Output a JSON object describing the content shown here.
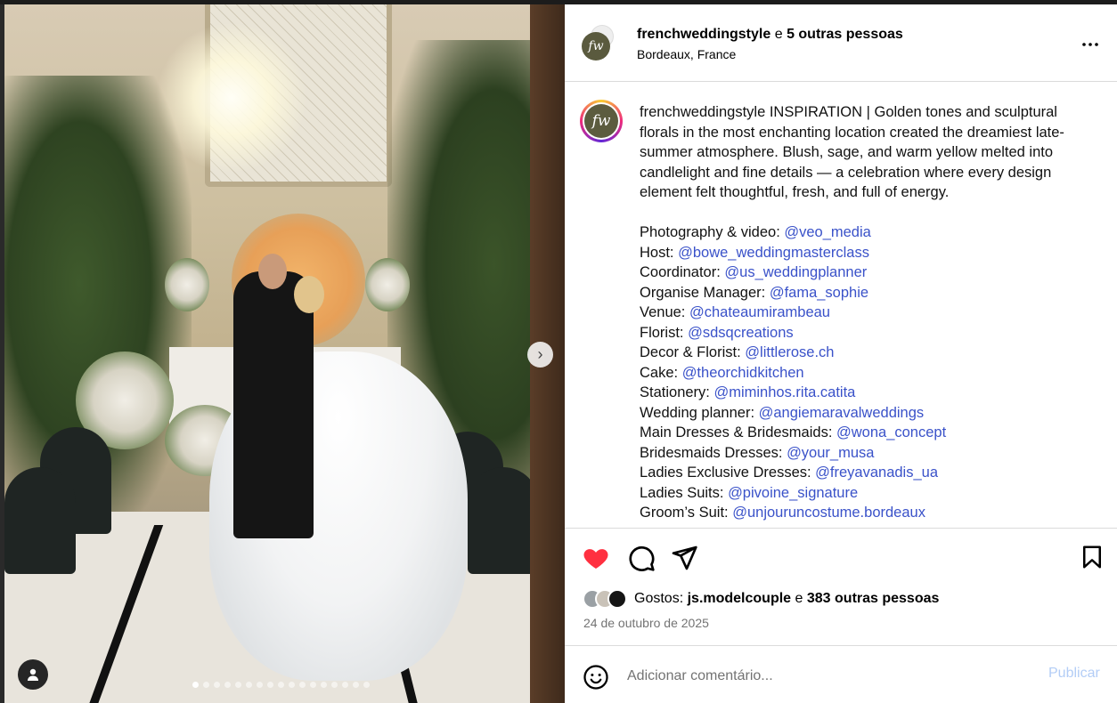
{
  "post": {
    "photo_alt": "Wedding couple at altar",
    "carousel_count": 17,
    "carousel_active_index": 0
  },
  "header": {
    "username": "frenchweddingstyle",
    "collab_conjunction": "e",
    "collab_others": "5 outras pessoas",
    "location": "Bordeaux, France",
    "avatar_initials": "fw",
    "more_icon": "more-horizontal-icon"
  },
  "caption": {
    "username": "frenchweddingstyle",
    "text": "INSPIRATION | Golden tones and sculptural florals in the most enchanting location created the dreamiest late-summer atmosphere. Blush, sage, and warm yellow melted into candlelight and fine details — a celebration where every design element felt thoughtful, fresh, and full of energy.",
    "credits": [
      {
        "label": "Photography & video: ",
        "handle": "@veo_media"
      },
      {
        "label": "Host: ",
        "handle": "@bowe_weddingmasterclass"
      },
      {
        "label": "Coordinator: ",
        "handle": "@us_weddingplanner"
      },
      {
        "label": "Organise Manager: ",
        "handle": "@fama_sophie"
      },
      {
        "label": "Venue: ",
        "handle": "@chateaumirambeau"
      },
      {
        "label": "Florist: ",
        "handle": "@sdsqcreations"
      },
      {
        "label": "Decor & Florist: ",
        "handle": "@littlerose.ch"
      },
      {
        "label": "Cake: ",
        "handle": "@theorchidkitchen"
      },
      {
        "label": "Stationery: ",
        "handle": "@miminhos.rita.catita"
      },
      {
        "label": "Wedding planner: ",
        "handle": "@angiemaravalweddings"
      },
      {
        "label": "Main Dresses & Bridesmaids: ",
        "handle": "@wona_concept"
      },
      {
        "label": "Bridesmaids Dresses: ",
        "handle": "@your_musa"
      },
      {
        "label": "Ladies Exclusive Dresses: ",
        "handle": "@freyavanadis_ua"
      },
      {
        "label": "Ladies Suits: ",
        "handle": "@pivoine_signature"
      },
      {
        "label": "Groom’s Suit: ",
        "handle": "@unjouruncostume.bordeaux"
      }
    ]
  },
  "actions": {
    "like_icon": "heart-filled-icon",
    "comment_icon": "comment-icon",
    "share_icon": "send-icon",
    "save_icon": "bookmark-icon",
    "liked_color": "#ff3040"
  },
  "likes": {
    "prefix": "Gostos:",
    "user": "js.modelcouple",
    "conjunction": "e",
    "others": "383 outras pessoas"
  },
  "date": "24 de outubro de 2025",
  "comment": {
    "placeholder": "Adicionar comentário...",
    "publish_label": "Publicar",
    "emoji_icon": "emoji-icon"
  },
  "colors": {
    "mention": "#3a52c9",
    "publish_disabled": "#b3cdf6"
  }
}
